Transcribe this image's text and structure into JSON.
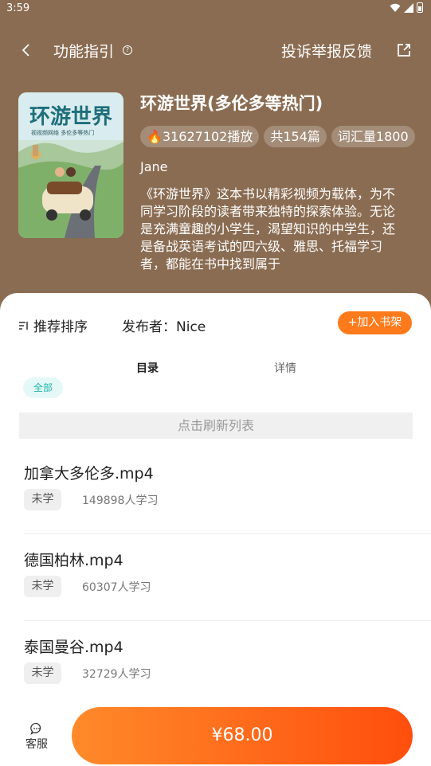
{
  "status_bar": {
    "time": "3:59"
  },
  "nav": {
    "title": "功能指引",
    "help_mark": "?",
    "report": "投诉举报反馈"
  },
  "book": {
    "cover": {
      "title": "环游世界",
      "subtitle": "视视频网络 多伦多等热门"
    },
    "title": "环游世界(多伦多等热门)",
    "tags": [
      "🔥31627102播放",
      "共154篇",
      "词汇量1800"
    ],
    "author": "Jane",
    "description": "《环游世界》这本书以精彩视频为载体，为不同学习阶段的读者带来独特的探索体验。无论是充满童趣的小学生，渴望知识的中学生，还是备战英语考试的四六级、雅思、托福学习者，都能在书中找到属于"
  },
  "toolbar": {
    "sort_label": "推荐排序",
    "publisher": "发布者：Nice",
    "add_shelf": "+加入书架"
  },
  "tabs": {
    "catalog": "目录",
    "detail": "详情"
  },
  "filter": {
    "all": "全部"
  },
  "refresh": "点击刷新列表",
  "items": [
    {
      "name": "加拿大多伦多.mp4",
      "status": "未学",
      "learners": "149898人学习"
    },
    {
      "name": "德国柏林.mp4",
      "status": "未学",
      "learners": "60307人学习"
    },
    {
      "name": "泰国曼谷.mp4",
      "status": "未学",
      "learners": "32729人学习"
    }
  ],
  "bottom": {
    "service": "客服",
    "price": "¥68.00"
  },
  "colors": {
    "header_bg": "#8a6c52",
    "accent": "#ff7a1a",
    "teal": "#22b3a6"
  }
}
